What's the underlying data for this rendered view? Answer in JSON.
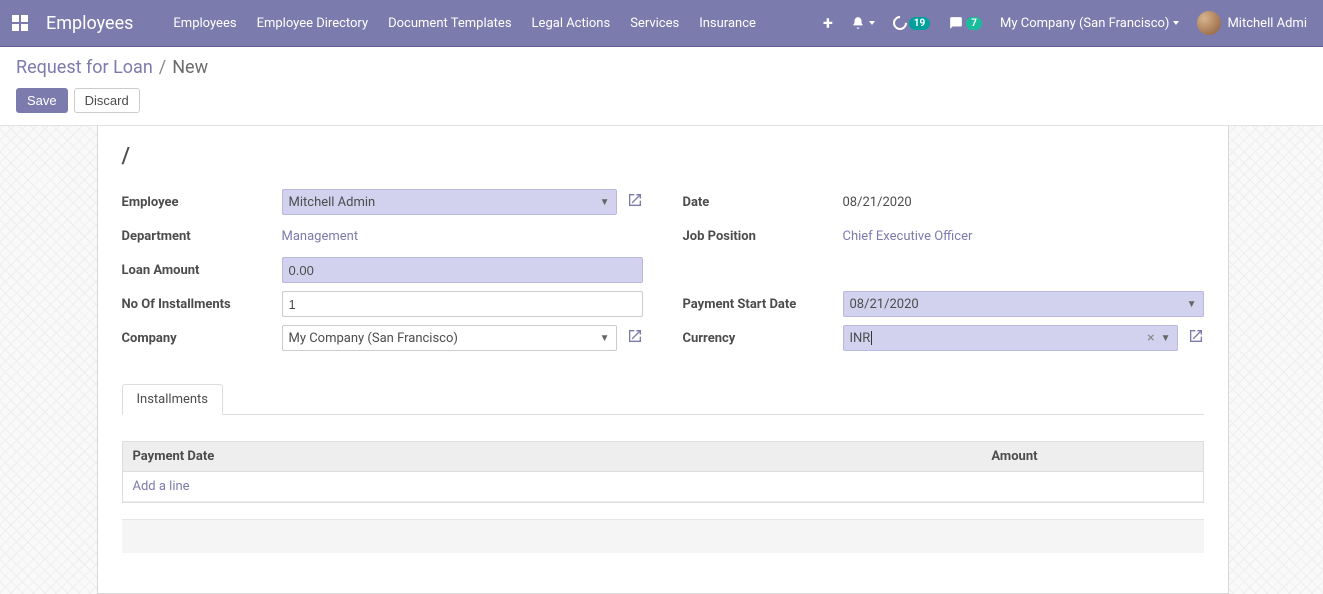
{
  "nav": {
    "brand": "Employees",
    "menu": [
      "Employees",
      "Employee Directory",
      "Document Templates",
      "Legal Actions",
      "Services",
      "Insurance"
    ],
    "activity_count": "19",
    "discuss_count": "7",
    "company": "My Company (San Francisco)",
    "user": "Mitchell Admi"
  },
  "breadcrumb": {
    "root": "Request for Loan",
    "current": "New"
  },
  "buttons": {
    "save": "Save",
    "discard": "Discard"
  },
  "title": "/",
  "form": {
    "employee_label": "Employee",
    "employee_value": "Mitchell Admin",
    "department_label": "Department",
    "department_value": "Management",
    "loan_amount_label": "Loan Amount",
    "loan_amount_value": "0.00",
    "installments_label": "No Of Installments",
    "installments_value": "1",
    "company_label": "Company",
    "company_value": "My Company (San Francisco)",
    "date_label": "Date",
    "date_value": "08/21/2020",
    "job_label": "Job Position",
    "job_value": "Chief Executive Officer",
    "pay_start_label": "Payment Start Date",
    "pay_start_value": "08/21/2020",
    "currency_label": "Currency",
    "currency_value": "INR"
  },
  "tabs": {
    "installments": "Installments"
  },
  "table": {
    "col_payment_date": "Payment Date",
    "col_amount": "Amount",
    "add_line": "Add a line"
  }
}
